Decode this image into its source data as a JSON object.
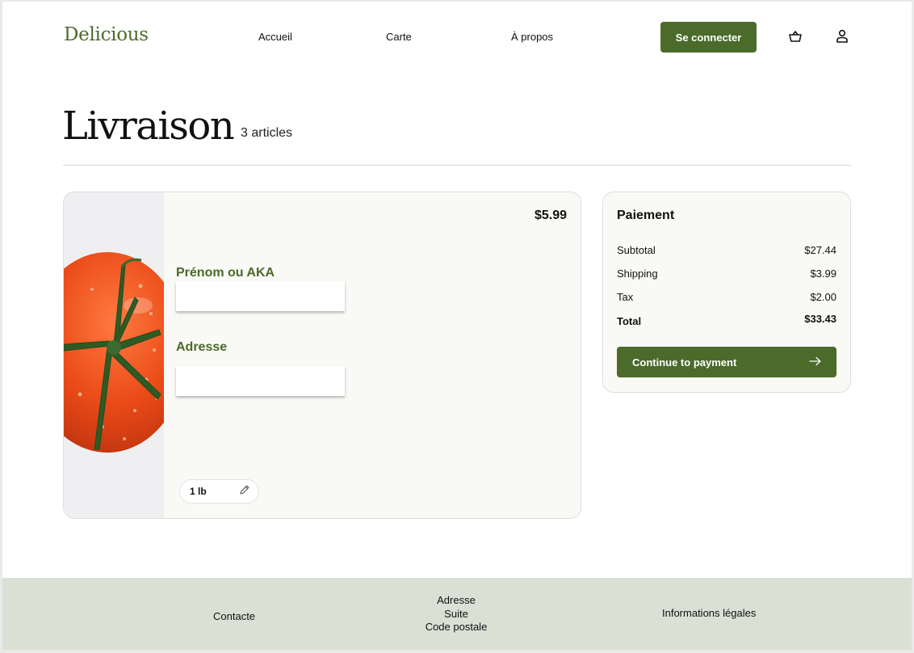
{
  "header": {
    "logo": "Delicious",
    "nav": [
      "Accueil",
      "Carte",
      "À propos"
    ],
    "login_label": "Se connecter",
    "icons": [
      "basket-icon",
      "user-icon"
    ]
  },
  "page": {
    "title": "Livraison",
    "item_count": "3 articles"
  },
  "cart_item": {
    "price": "$5.99",
    "name_label": "Prénom ou  AKA",
    "name_value": "",
    "address_label": "Adresse",
    "address_value": "",
    "quantity": "1 lb",
    "image": "tomato-image"
  },
  "payment": {
    "title": "Paiement",
    "rows": [
      {
        "label": "Subtotal",
        "value": "$27.44"
      },
      {
        "label": "Shipping",
        "value": "$3.99"
      },
      {
        "label": "Tax",
        "value": "$2.00"
      },
      {
        "label": "Total",
        "value": "$33.43"
      }
    ],
    "cta": "Continue to payment"
  },
  "footer": {
    "contact": "Contacte",
    "address_lines": [
      "Adresse",
      "Suite",
      "Code postale"
    ],
    "legal": "Informations légales"
  },
  "colors": {
    "brand_green": "#4a6b2a",
    "footer_bg": "#dbe0d5",
    "card_bg": "#f9f9f6"
  }
}
